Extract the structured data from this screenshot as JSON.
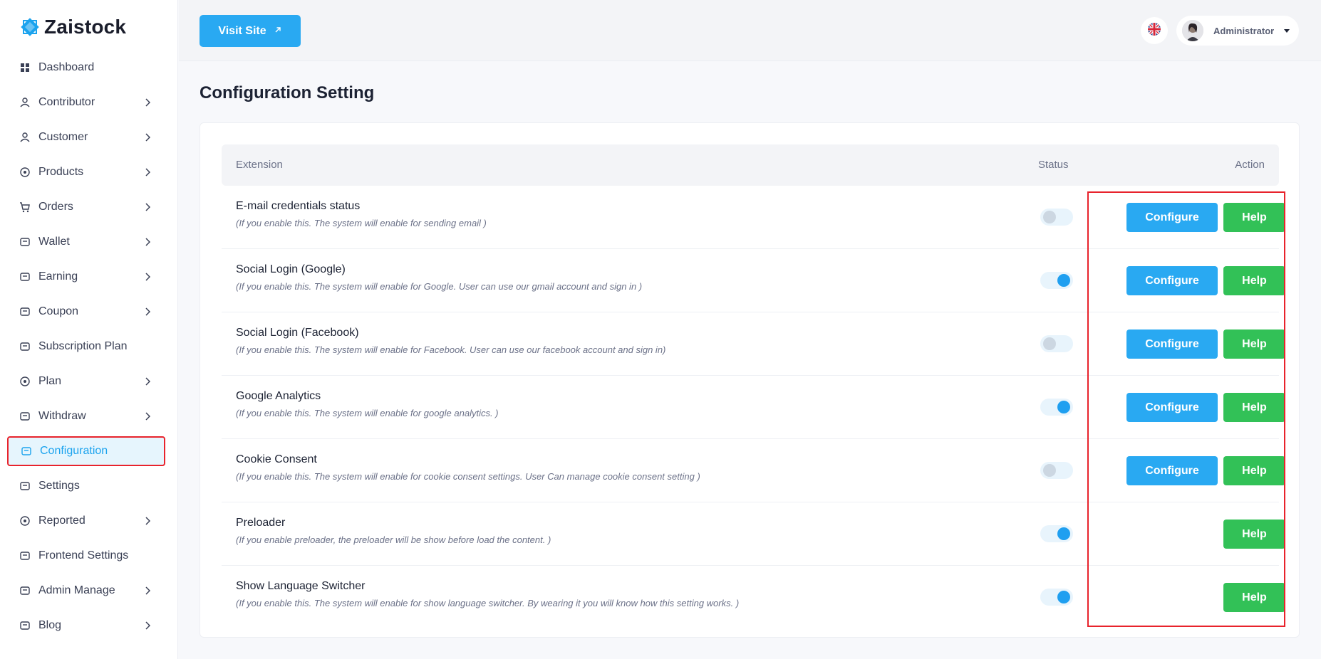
{
  "brand": {
    "name": "Zaistock",
    "accent": "#29a9f2"
  },
  "sidebar": {
    "items": [
      {
        "label": "Dashboard",
        "icon": "dashboard-icon",
        "has_chevron": false
      },
      {
        "label": "Contributor",
        "icon": "contributor-icon",
        "has_chevron": true
      },
      {
        "label": "Customer",
        "icon": "customer-icon",
        "has_chevron": true
      },
      {
        "label": "Products",
        "icon": "products-icon",
        "has_chevron": true
      },
      {
        "label": "Orders",
        "icon": "cart-icon",
        "has_chevron": true
      },
      {
        "label": "Wallet",
        "icon": "wallet-icon",
        "has_chevron": true
      },
      {
        "label": "Earning",
        "icon": "earning-icon",
        "has_chevron": true
      },
      {
        "label": "Coupon",
        "icon": "coupon-icon",
        "has_chevron": true
      },
      {
        "label": "Subscription Plan",
        "icon": "subscription-icon",
        "has_chevron": false
      },
      {
        "label": "Plan",
        "icon": "plan-icon",
        "has_chevron": true
      },
      {
        "label": "Withdraw",
        "icon": "withdraw-icon",
        "has_chevron": true
      },
      {
        "label": "Configuration",
        "icon": "configuration-icon",
        "has_chevron": false,
        "active": true
      },
      {
        "label": "Settings",
        "icon": "settings-icon",
        "has_chevron": false
      },
      {
        "label": "Reported",
        "icon": "reported-icon",
        "has_chevron": true
      },
      {
        "label": "Frontend Settings",
        "icon": "frontend-icon",
        "has_chevron": false
      },
      {
        "label": "Admin Manage",
        "icon": "admin-icon",
        "has_chevron": true
      },
      {
        "label": "Blog",
        "icon": "blog-icon",
        "has_chevron": true
      }
    ]
  },
  "topbar": {
    "visit_label": "Visit Site",
    "user_name": "Administrator",
    "language_icon": "uk-flag-icon"
  },
  "main": {
    "title": "Configuration Setting",
    "table": {
      "headers": {
        "extension": "Extension",
        "status": "Status",
        "action": "Action"
      },
      "rows": [
        {
          "title": "E-mail credentials status",
          "desc": "(If you enable this. The system will enable for sending email )",
          "enabled": false,
          "configure": "Configure",
          "help": "Help"
        },
        {
          "title": "Social Login (Google)",
          "desc": "(If you enable this. The system will enable for Google. User can use our gmail account and sign in )",
          "enabled": true,
          "configure": "Configure",
          "help": "Help"
        },
        {
          "title": "Social Login (Facebook)",
          "desc": "(If you enable this. The system will enable for Facebook. User can use our facebook account and sign in)",
          "enabled": false,
          "configure": "Configure",
          "help": "Help"
        },
        {
          "title": "Google Analytics",
          "desc": "(If you enable this. The system will enable for google analytics. )",
          "enabled": true,
          "configure": "Configure",
          "help": "Help"
        },
        {
          "title": "Cookie Consent",
          "desc": "(If you enable this. The system will enable for cookie consent settings. User Can manage cookie consent setting )",
          "enabled": false,
          "configure": "Configure",
          "help": "Help"
        },
        {
          "title": "Preloader",
          "desc": "(If you enable preloader, the preloader will be show before load the content. )",
          "enabled": true,
          "configure": null,
          "help": "Help"
        },
        {
          "title": "Show Language Switcher",
          "desc": "(If you enable this. The system will enable for show language switcher. By wearing it you will know how this setting works. )",
          "enabled": true,
          "configure": null,
          "help": "Help"
        }
      ]
    }
  }
}
